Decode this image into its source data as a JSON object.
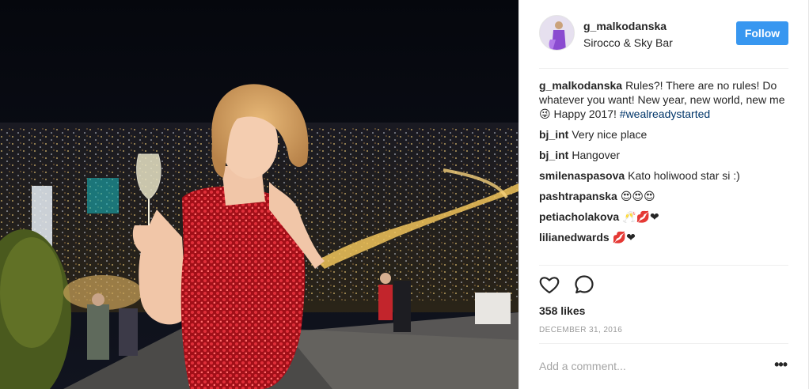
{
  "header": {
    "username": "g_malkodanska",
    "location": "Sirocco & Sky Bar",
    "follow_label": "Follow"
  },
  "caption": {
    "user": "g_malkodanska",
    "text": "Rules?! There are no rules! Do whatever you want! New year, new world, new me 😜 Happy 2017!",
    "hashtag": "#wealreadystarted"
  },
  "comments": [
    {
      "user": "bj_int",
      "text": "Very nice place"
    },
    {
      "user": "bj_int",
      "text": "Hangover"
    },
    {
      "user": "smilenaspasova",
      "text": "Kato holiwood star si :)"
    },
    {
      "user": "pashtrapanska",
      "text": "😍😍😍"
    },
    {
      "user": "petiacholakova",
      "text": "🥂💋❤"
    },
    {
      "user": "lilianedwards",
      "text": "💋❤"
    }
  ],
  "actions": {
    "like_icon": "heart-icon",
    "comment_icon": "comment-icon"
  },
  "likes": "358 likes",
  "date": "DECEMBER 31, 2016",
  "add_comment": {
    "placeholder": "Add a comment..."
  },
  "more_label": "•••",
  "colors": {
    "follow_button": "#3897f0",
    "hashtag": "#003569",
    "dress": "#c0161f"
  }
}
